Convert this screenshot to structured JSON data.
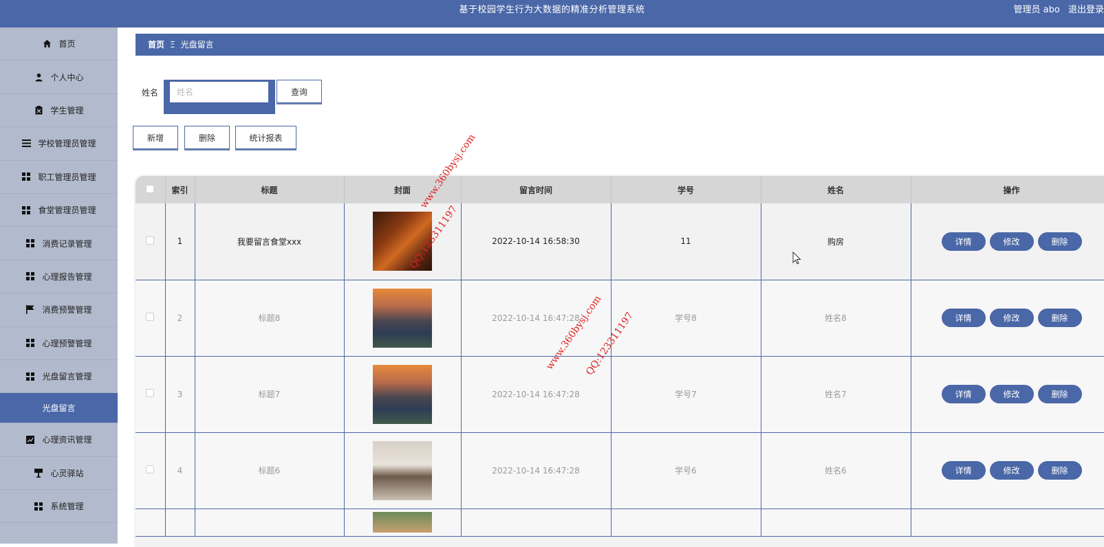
{
  "header": {
    "title": "基于校园学生行为大数据的精准分析管理系统",
    "role_label": "管理员 abo",
    "logout_label": "退出登录"
  },
  "sidebar": {
    "items": [
      {
        "label": "首页",
        "icon": "home-icon"
      },
      {
        "label": "个人中心",
        "icon": "user-icon"
      },
      {
        "label": "学生管理",
        "icon": "clipboard-icon"
      },
      {
        "label": "学校管理员管理",
        "icon": "list-icon"
      },
      {
        "label": "职工管理员管理",
        "icon": "grid-icon"
      },
      {
        "label": "食堂管理员管理",
        "icon": "grid-icon"
      },
      {
        "label": "消费记录管理",
        "icon": "grid-icon"
      },
      {
        "label": "心理报告管理",
        "icon": "grid-icon"
      },
      {
        "label": "消费预警管理",
        "icon": "flag-icon"
      },
      {
        "label": "心理预警管理",
        "icon": "grid-icon"
      },
      {
        "label": "光盘留言管理",
        "icon": "grid-icon"
      },
      {
        "label": "光盘留言",
        "icon": "",
        "active": true
      },
      {
        "label": "心理资讯管理",
        "icon": "chart-icon"
      },
      {
        "label": "心灵驿站",
        "icon": "stand-icon"
      },
      {
        "label": "系统管理",
        "icon": "grid-icon"
      }
    ]
  },
  "breadcrumb": {
    "home": "首页",
    "separator": "Ξ",
    "current": "光盘留言"
  },
  "search": {
    "label": "姓名",
    "placeholder": "姓名",
    "value": "",
    "button": "查询"
  },
  "actions": {
    "add": "新增",
    "delete": "删除",
    "report": "统计报表"
  },
  "table": {
    "headers": [
      "索引",
      "标题",
      "封面",
      "留言时间",
      "学号",
      "姓名",
      "操作"
    ],
    "rows": [
      {
        "index": "1",
        "title": "我要留言食堂xxx",
        "cover": "fire",
        "time": "2022-10-14 16:58:30",
        "sid": "11",
        "name": "购房"
      },
      {
        "index": "2",
        "title": "标题8",
        "cover": "city",
        "time": "2022-10-14 16:47:28",
        "sid": "学号8",
        "name": "姓名8"
      },
      {
        "index": "3",
        "title": "标题7",
        "cover": "city",
        "time": "2022-10-14 16:47:28",
        "sid": "学号7",
        "name": "姓名7"
      },
      {
        "index": "4",
        "title": "标题6",
        "cover": "room",
        "time": "2022-10-14 16:47:28",
        "sid": "学号6",
        "name": "姓名6"
      }
    ],
    "row_actions": {
      "detail": "详情",
      "edit": "修改",
      "delete": "删除"
    }
  },
  "watermarks": {
    "site": "www.360bysj.com",
    "qq": "QQ:123311197"
  },
  "colors": {
    "primary": "#4a67a7",
    "sidebar": "#b2bbcd",
    "header_row": "#d6d6d6"
  }
}
